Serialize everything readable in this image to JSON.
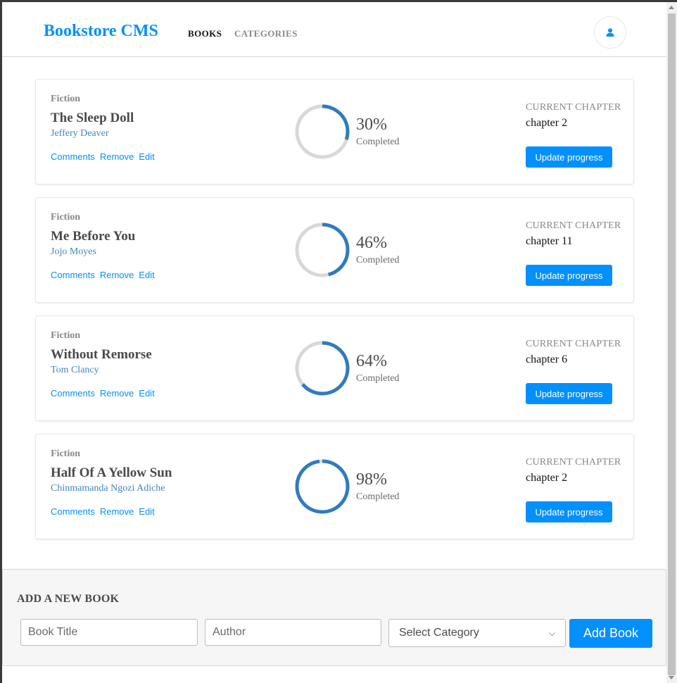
{
  "header": {
    "brand": "Bookstore CMS",
    "nav": [
      {
        "label": "BOOKS",
        "active": true
      },
      {
        "label": "CATEGORIES",
        "active": false
      }
    ],
    "user_icon": "user-icon"
  },
  "books": [
    {
      "genre": "Fiction",
      "title": "The Sleep Doll",
      "author": "Jeffery Deaver",
      "actions": [
        "Comments",
        "Remove",
        "Edit"
      ],
      "percent": 30,
      "percent_label": "30%",
      "completed_label": "Completed",
      "chapter_label": "CURRENT CHAPTER",
      "chapter": "chapter 2",
      "update_label": "Update progress"
    },
    {
      "genre": "Fiction",
      "title": "Me Before You",
      "author": "Jojo Moyes",
      "actions": [
        "Comments",
        "Remove",
        "Edit"
      ],
      "percent": 46,
      "percent_label": "46%",
      "completed_label": "Completed",
      "chapter_label": "CURRENT CHAPTER",
      "chapter": "chapter 11",
      "update_label": "Update progress"
    },
    {
      "genre": "Fiction",
      "title": "Without Remorse",
      "author": "Tom Clancy",
      "actions": [
        "Comments",
        "Remove",
        "Edit"
      ],
      "percent": 64,
      "percent_label": "64%",
      "completed_label": "Completed",
      "chapter_label": "CURRENT CHAPTER",
      "chapter": "chapter 6",
      "update_label": "Update progress"
    },
    {
      "genre": "Fiction",
      "title": "Half Of A Yellow Sun",
      "author": "Chinmamanda Ngozi Adiche",
      "actions": [
        "Comments",
        "Remove",
        "Edit"
      ],
      "percent": 98,
      "percent_label": "98%",
      "completed_label": "Completed",
      "chapter_label": "CURRENT CHAPTER",
      "chapter": "chapter 2",
      "update_label": "Update progress"
    }
  ],
  "add_form": {
    "heading": "ADD A NEW BOOK",
    "title_placeholder": "Book Title",
    "author_placeholder": "Author",
    "category_selected": "Select Category",
    "submit_label": "Add Book"
  },
  "colors": {
    "accent": "#0290ff",
    "progress": "#307bbe",
    "progress_track": "#d8d8d8",
    "author": "#4386bf"
  }
}
